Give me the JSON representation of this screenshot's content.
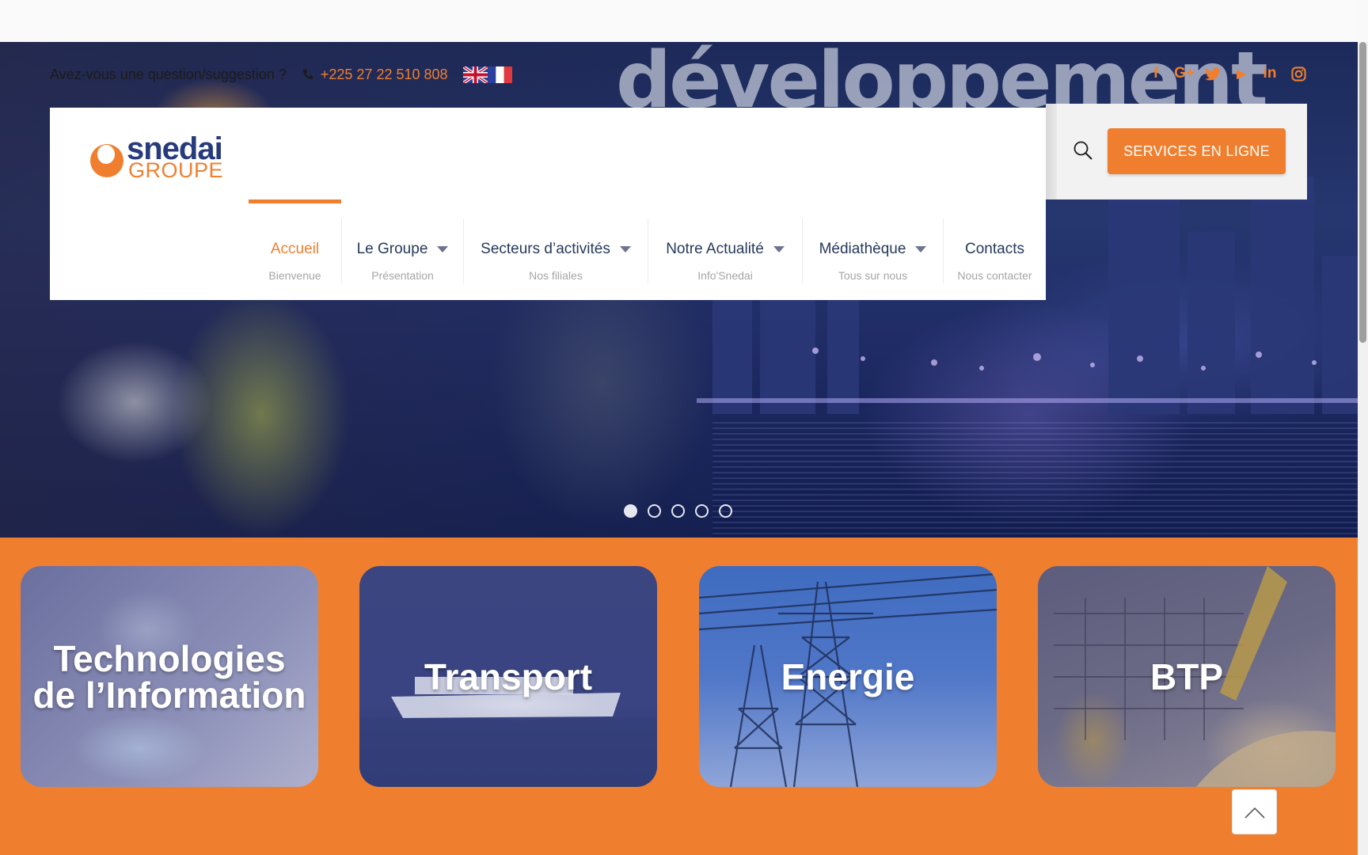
{
  "hero": {
    "headline_word": "développement"
  },
  "topbar": {
    "question": "Avez-vous une question/suggestion ?",
    "phone": "+225 27 22 510 808",
    "flags": [
      "english-flag",
      "french-flag"
    ]
  },
  "social": {
    "icons": [
      "facebook-icon",
      "google-plus-icon",
      "twitter-icon",
      "youtube-icon",
      "linkedin-icon",
      "instagram-icon"
    ],
    "glyphs": [
      "f",
      "G+",
      "",
      "▶",
      "in",
      ""
    ]
  },
  "logo": {
    "name": "snedai",
    "sub": "GROUPE"
  },
  "nav": {
    "items": [
      {
        "label": "Accueil",
        "sub": "Bienvenue",
        "active": true,
        "dropdown": false
      },
      {
        "label": "Le Groupe",
        "sub": "Présentation",
        "active": false,
        "dropdown": true
      },
      {
        "label": "Secteurs d’activités",
        "sub": "Nos filiales",
        "active": false,
        "dropdown": true
      },
      {
        "label": "Notre Actualité",
        "sub": "Info'Snedai",
        "active": false,
        "dropdown": true
      },
      {
        "label": "Médiathèque",
        "sub": "Tous sur nous",
        "active": false,
        "dropdown": true
      },
      {
        "label": "Contacts",
        "sub": "Nous contacter",
        "active": false,
        "dropdown": false
      }
    ]
  },
  "services_button": "SERVICES EN LIGNE",
  "slider": {
    "slides": 5,
    "active_index": 0
  },
  "sectors": [
    {
      "title_line1": "Technologies",
      "title_line2": "de l’Information"
    },
    {
      "title_line1": "Transport",
      "title_line2": ""
    },
    {
      "title_line1": "Energie",
      "title_line2": ""
    },
    {
      "title_line1": "BTP",
      "title_line2": ""
    }
  ],
  "colors": {
    "accent": "#ef7f2f",
    "brand_blue": "#263a7c",
    "nav_text": "#263a5c"
  }
}
